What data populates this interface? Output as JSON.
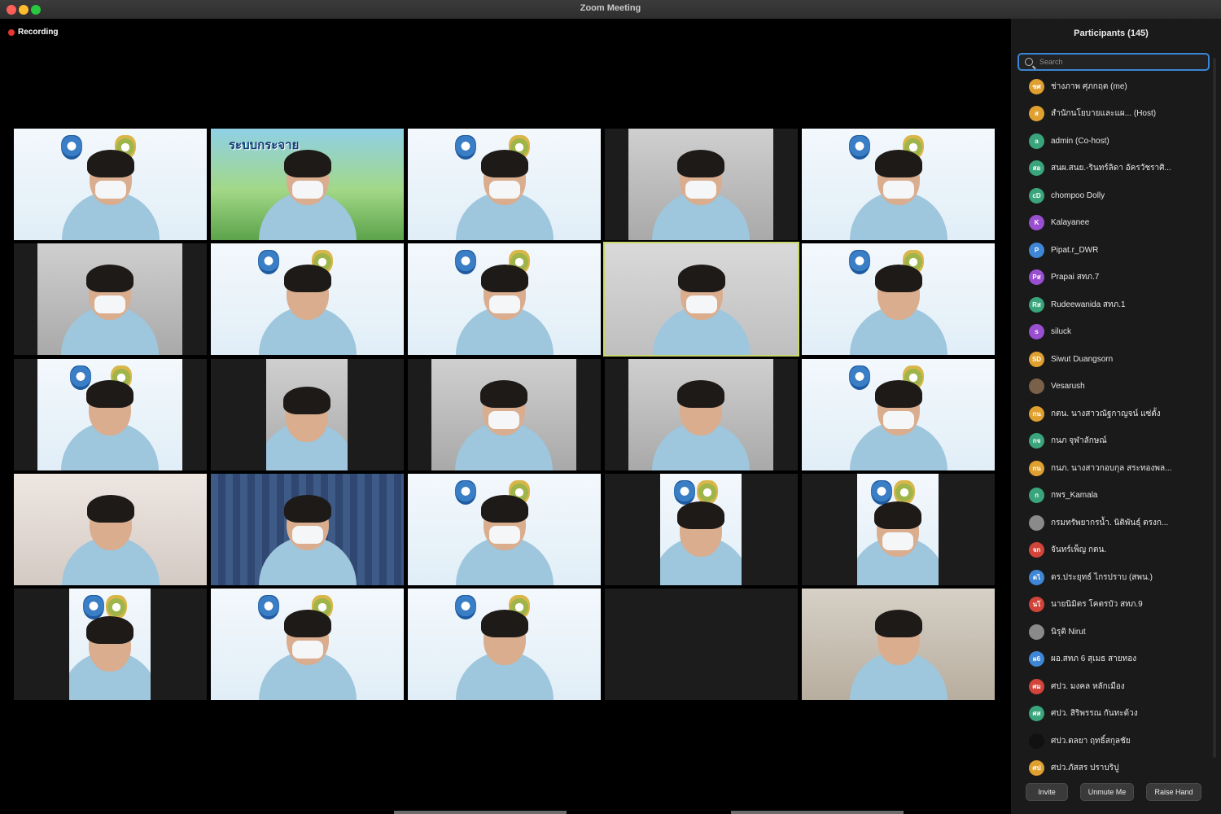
{
  "window": {
    "title": "Zoom Meeting"
  },
  "recording": {
    "label": "Recording"
  },
  "participants_panel": {
    "title": "Participants (145)",
    "search_placeholder": "Search",
    "participants": [
      {
        "initials": "ชศ",
        "name": "ช่างภาพ  ศุภกฤต (me)",
        "color": "#e0a030"
      },
      {
        "initials": "ส",
        "name": "สำนักนโยบายและแผ...  (Host)",
        "color": "#e0a030"
      },
      {
        "initials": "a",
        "name": "admin (Co-host)",
        "color": "#3aa57c"
      },
      {
        "initials": "สอ",
        "name": "สนผ.สนย.-รินทร์ลิดา อัครวัชราศิ...",
        "color": "#3aa57c"
      },
      {
        "initials": "cD",
        "name": "chompoo Dolly",
        "color": "#3aa57c"
      },
      {
        "initials": "K",
        "name": "Kalayanee",
        "color": "#9a4fd0"
      },
      {
        "initials": "P",
        "name": "Pipat.r_DWR",
        "color": "#3f87d6"
      },
      {
        "initials": "Pส",
        "name": "Prapai สทภ.7",
        "color": "#9a4fd0"
      },
      {
        "initials": "Rส",
        "name": "Rudeewanida สทภ.1",
        "color": "#3aa57c"
      },
      {
        "initials": "s",
        "name": "siluck",
        "color": "#9a4fd0"
      },
      {
        "initials": "SD",
        "name": "Siwut Duangsorn",
        "color": "#e0a030"
      },
      {
        "initials": "",
        "name": "Vesarush",
        "color": "#7a6048"
      },
      {
        "initials": "กน",
        "name": "กตน. นางสาวณัฐกาญจน์ แซ่ตั้ง",
        "color": "#e0a030"
      },
      {
        "initials": "กจ",
        "name": "กนภ จุฬาลักษณ์",
        "color": "#3aa57c"
      },
      {
        "initials": "กน",
        "name": "กนภ. นางสาวกอบกุล สระทองพล...",
        "color": "#e0a030"
      },
      {
        "initials": "ก",
        "name": "กพร_Kamala",
        "color": "#3aa57c"
      },
      {
        "initials": "",
        "name": "กรมทรัพยากรน้ำ. นิติพันธุ์ ตรงก...",
        "color": "#8a8a8a"
      },
      {
        "initials": "จก",
        "name": "จันทร์เพ็ญ กตน.",
        "color": "#d2443a"
      },
      {
        "initials": "ดไ",
        "name": "ดร.ประยุทธ์ ไกรปราบ (สพน.)",
        "color": "#3f87d6"
      },
      {
        "initials": "นโ",
        "name": "นายนิมิตร โคตรบัว สทภ.9",
        "color": "#d2443a"
      },
      {
        "initials": "",
        "name": "นิรุติ Nirut",
        "color": "#8a8a8a"
      },
      {
        "initials": "ผ6",
        "name": "ผอ.สทภ 6 สุเมธ สายทอง",
        "color": "#3f87d6"
      },
      {
        "initials": "ศม",
        "name": "ศปว. มงคล หลักเมือง",
        "color": "#d2443a"
      },
      {
        "initials": "ศส",
        "name": "ศปว. สิริพรรณ กันทะด้วง",
        "color": "#3aa57c"
      },
      {
        "initials": "",
        "name": "ศปว.ตลยา ฤทธิ์สกุลชัย",
        "color": "#111111"
      },
      {
        "initials": "ศป",
        "name": "ศปว.ภัสสร ปราบริปู",
        "color": "#e0a030"
      }
    ],
    "buttons": {
      "invite": "Invite",
      "unmute": "Unmute Me",
      "raise_hand": "Raise Hand"
    }
  },
  "video_tiles": [
    {
      "id": 1,
      "kind": "banner",
      "banner_text": "ระบบกระจาย"
    }
  ]
}
